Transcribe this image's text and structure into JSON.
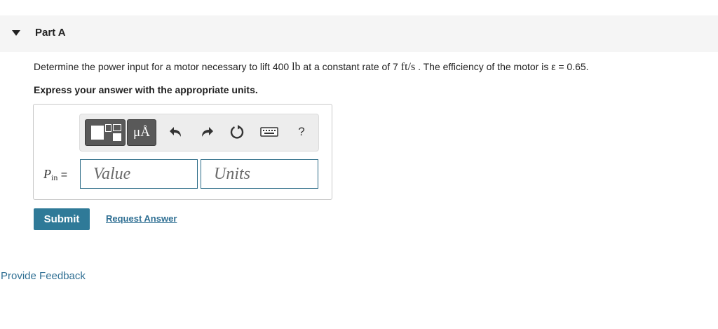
{
  "part": {
    "title": "Part A"
  },
  "question": {
    "prefix": "Determine the power input for a motor necessary to lift 400",
    "weight_unit": "lb",
    "middle": "at a constant rate of 7",
    "rate_unit": "ft/s",
    "suffix": ". The efficiency of the motor is ε = 0.65."
  },
  "instruction": "Express your answer with the appropriate units.",
  "toolbar": {
    "templates_icon": "templates-icon",
    "units_label": "μÅ",
    "undo_icon": "undo-icon",
    "redo_icon": "redo-icon",
    "reset_icon": "reset-icon",
    "keyboard_icon": "keyboard-icon",
    "help_label": "?"
  },
  "answer": {
    "variable": "P",
    "subscript": "in",
    "equals": "=",
    "value_placeholder": "Value",
    "units_placeholder": "Units"
  },
  "actions": {
    "submit_label": "Submit",
    "request_label": "Request Answer"
  },
  "footer": {
    "feedback_label": "Provide Feedback"
  },
  "colors": {
    "accent": "#2f7a98",
    "link": "#2f6f93",
    "field_border": "#2a6a86"
  }
}
